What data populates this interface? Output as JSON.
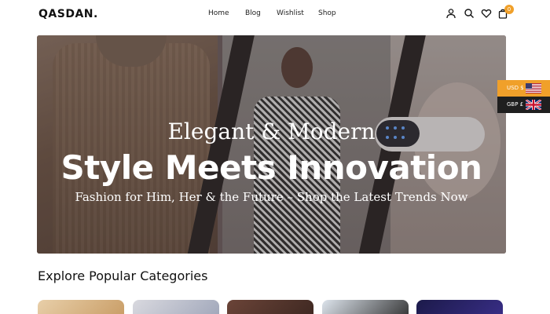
{
  "header": {
    "logo": "QASDAN.",
    "nav": [
      {
        "label": "Home"
      },
      {
        "label": "Blog"
      },
      {
        "label": "Wishlist"
      },
      {
        "label": "Shop"
      }
    ],
    "icons": [
      "user-icon",
      "search-icon",
      "heart-icon",
      "cart-icon"
    ],
    "cart_count": "0",
    "badge_color": "#f0a02a"
  },
  "hero": {
    "line1": "Elegant & Modern",
    "line2": "Style Meets Innovation",
    "line3": "Fashion for Him, Her & the Future – Shop the Latest Trends Now"
  },
  "currency": {
    "usd_label": "USD $",
    "gbp_label": "GBP £",
    "usd_color": "#f0a02a",
    "gbp_color": "#1f1f1f"
  },
  "categories": {
    "title": "Explore Popular Categories",
    "card_colors": [
      "#e8cfa9",
      "#b8b8c4",
      "#5a3a32",
      "#c9d2dc",
      "#231f5a"
    ]
  }
}
